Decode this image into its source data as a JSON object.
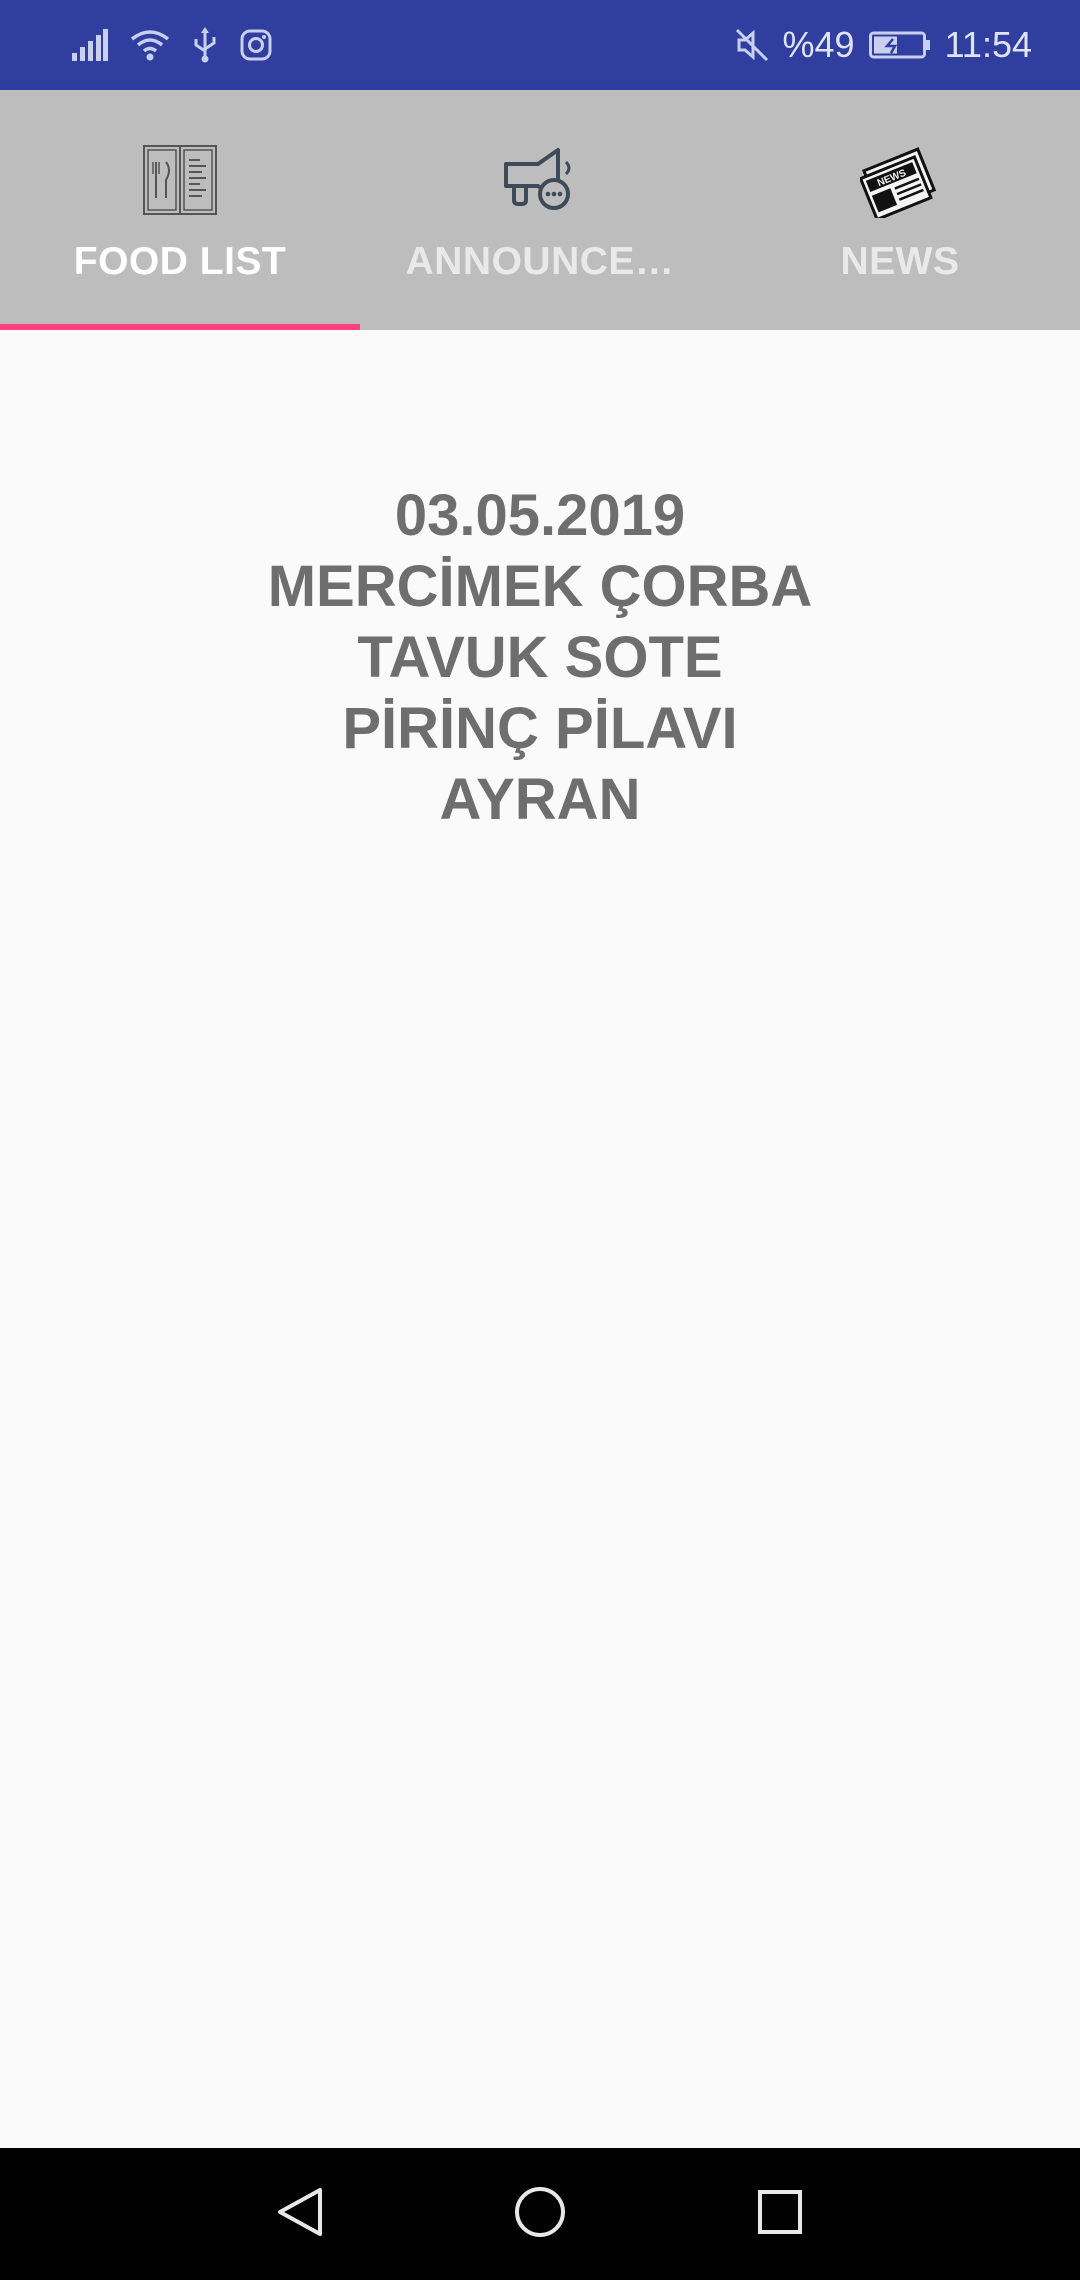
{
  "status_bar": {
    "left_icons": [
      "signal-icon",
      "wifi-icon",
      "usb-icon",
      "instagram-icon"
    ],
    "right_icons": [
      "mute-icon",
      "battery-icon"
    ],
    "battery_text": "%49",
    "battery_level": 0.49,
    "time": "11:54"
  },
  "tabs": [
    {
      "label": "FOOD LIST",
      "icon": "menu-book-icon",
      "active": true
    },
    {
      "label": "ANNOUNCE…",
      "icon": "megaphone-icon",
      "active": false
    },
    {
      "label": "NEWS",
      "icon": "newspaper-icon",
      "active": false
    }
  ],
  "colors": {
    "status_bar": "#303f9f",
    "tab_bar": "#bdbdbd",
    "indicator": "#ff4081",
    "menu_text": "#6e6e6e",
    "background": "#fafafa"
  },
  "menu": {
    "lines": [
      "03.05.2019",
      "MERCİMEK ÇORBA",
      "TAVUK SOTE",
      "PİRİNÇ PİLAVI",
      "AYRAN"
    ]
  },
  "nav_bar": {
    "buttons": [
      "back-icon",
      "home-icon",
      "recents-icon"
    ]
  }
}
